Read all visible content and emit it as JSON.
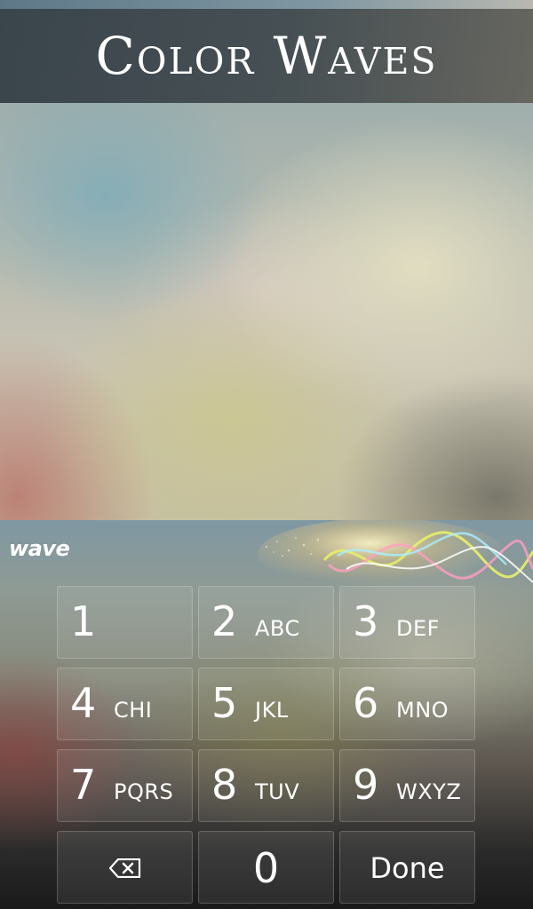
{
  "app": {
    "title": "Color Waves",
    "brand_logo": "wave"
  },
  "keypad": {
    "keys": [
      {
        "digit": "1",
        "letters": ""
      },
      {
        "digit": "2",
        "letters": "ABC"
      },
      {
        "digit": "3",
        "letters": "DEF"
      },
      {
        "digit": "4",
        "letters": "CHI"
      },
      {
        "digit": "5",
        "letters": "JKL"
      },
      {
        "digit": "6",
        "letters": "MNO"
      },
      {
        "digit": "7",
        "letters": "PQRS"
      },
      {
        "digit": "8",
        "letters": "TUV"
      },
      {
        "digit": "9",
        "letters": "WXYZ"
      }
    ],
    "zero": "0",
    "done_label": "Done",
    "backspace_icon": "backspace-icon"
  },
  "colors": {
    "banner_text": "#ffffff",
    "key_text": "#ffffff"
  }
}
